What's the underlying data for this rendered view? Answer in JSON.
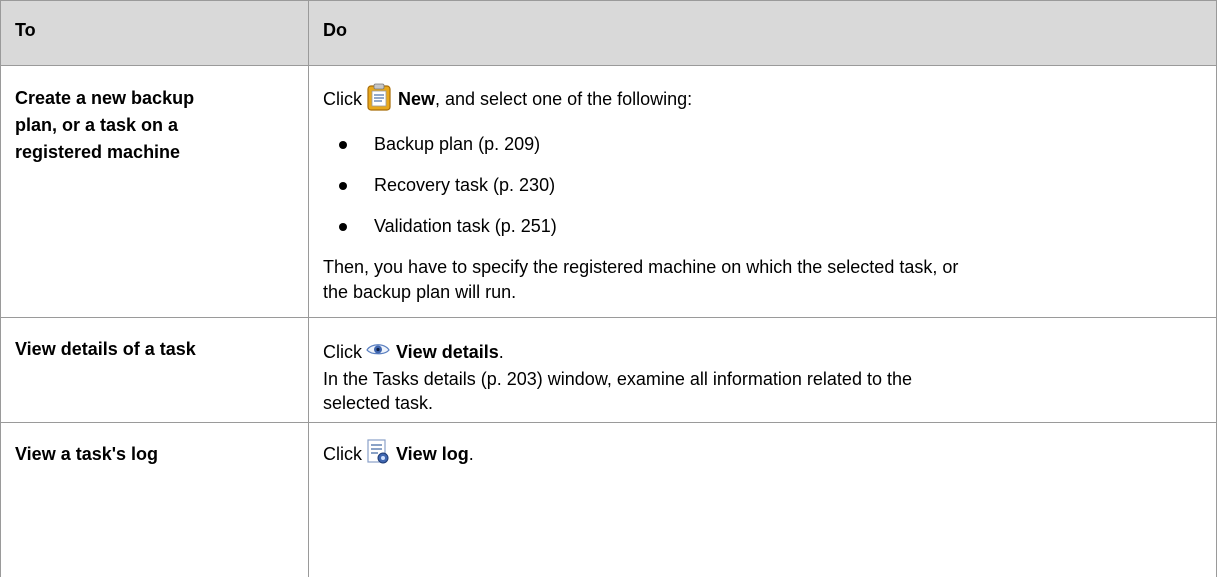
{
  "header": {
    "col1": "To",
    "col2": "Do"
  },
  "rows": [
    {
      "to_lines": [
        "Create a new backup",
        "plan, or a task on a",
        "registered machine"
      ],
      "click_prefix": "Click",
      "action": "New",
      "action_suffix": ", and select one of the following:",
      "bullets": [
        "Backup plan (p. 209)",
        "Recovery task (p. 230)",
        "Validation task (p. 251)"
      ],
      "note_lines": [
        "Then, you have to specify the registered machine on which the selected task, or",
        "the backup plan will run."
      ],
      "icon": "new-clipboard-icon"
    },
    {
      "to": "View details of a task",
      "click_prefix": "Click",
      "action": "View details",
      "action_suffix": ".",
      "detail_lines": [
        "In the Tasks details (p. 203) window, examine all information related to the",
        "selected task."
      ],
      "icon": "eye-icon"
    },
    {
      "to": "View a task's log",
      "click_prefix": "Click",
      "action": "View log",
      "action_suffix": ".",
      "icon": "log-icon"
    }
  ]
}
